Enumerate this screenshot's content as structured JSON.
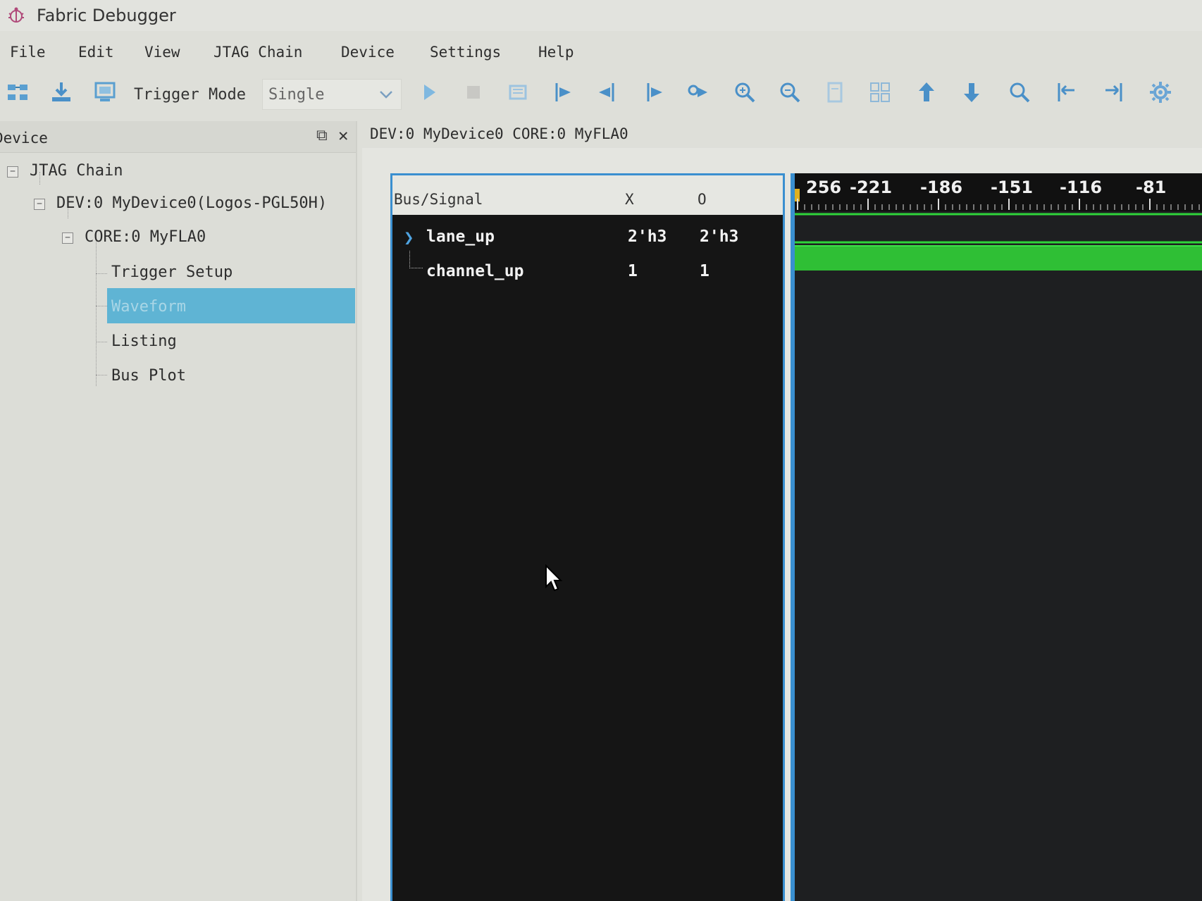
{
  "window": {
    "title": "Fabric Debugger"
  },
  "menu": [
    "File",
    "Edit",
    "View",
    "JTAG Chain",
    "Device",
    "Settings",
    "Help"
  ],
  "toolbar": {
    "trigger_mode_label": "Trigger Mode",
    "trigger_mode_value": "Single",
    "icons": [
      "scan-chain-icon",
      "download-icon",
      "device-screen-icon",
      "run-icon",
      "stop-icon",
      "capture-icon",
      "jump-trigger-icon",
      "prev-edge-icon",
      "next-edge-icon",
      "find-next-icon",
      "zoom-in-icon",
      "zoom-out-icon",
      "zoom-fit-icon",
      "group-icon",
      "move-up-icon",
      "move-down-icon",
      "search-icon",
      "align-left-icon",
      "align-right-icon",
      "settings-gear-icon"
    ]
  },
  "device_panel": {
    "title": "Device",
    "tree": {
      "chain": "JTAG Chain",
      "device": "DEV:0 MyDevice0(Logos-PGL50H)",
      "core": "CORE:0 MyFLA0",
      "views": [
        "Trigger Setup",
        "Waveform",
        "Listing",
        "Bus Plot"
      ],
      "selected": "Waveform"
    }
  },
  "path": "DEV:0 MyDevice0 CORE:0 MyFLA0",
  "signal_table": {
    "columns": [
      "Bus/Signal",
      "X",
      "O"
    ],
    "rows": [
      {
        "name": "lane_up",
        "x": "2'h3",
        "o": "2'h3"
      },
      {
        "name": "channel_up",
        "x": "1",
        "o": "1"
      }
    ]
  },
  "waveform": {
    "ruler_labels": [
      "256",
      "-221",
      "-186",
      "-151",
      "-116",
      "-81"
    ],
    "trace_color": "#2fd43a"
  },
  "colors": {
    "selection": "#5fb4d4",
    "accent": "#3a8fd0",
    "trace": "#2fd43a"
  }
}
